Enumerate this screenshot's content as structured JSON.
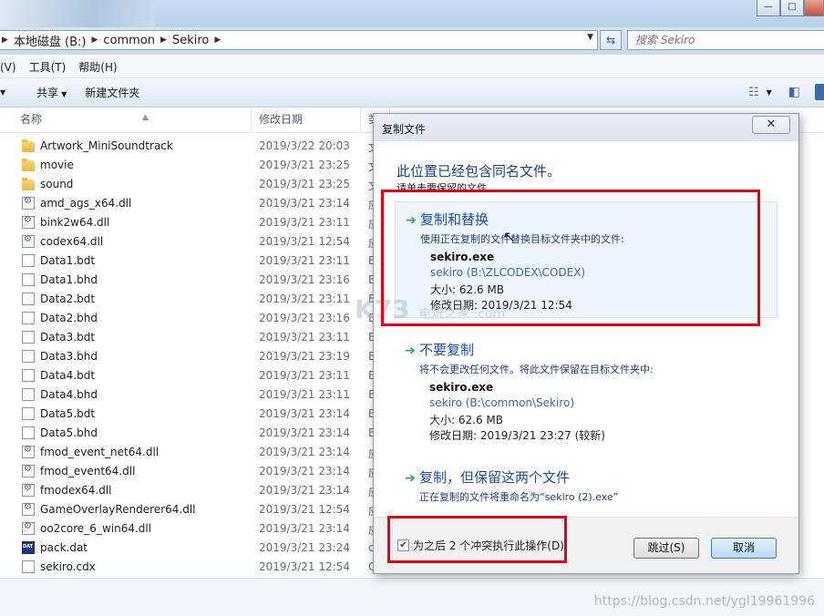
{
  "explorer": {
    "address": {
      "crumbs": [
        "本地磁盘 (B:)",
        "common",
        "Sekiro"
      ]
    },
    "search": {
      "placeholder": "搜索 Sekiro"
    },
    "window_buttons": {
      "minimize": "—",
      "maximize": "□"
    },
    "menu": [
      "(V)",
      "工具(T)",
      "帮助(H)"
    ],
    "toolbar": {
      "share": "共享",
      "new_folder": "新建文件夹"
    },
    "columns": {
      "name": "名称",
      "date": "修改日期",
      "type": "类"
    },
    "files": [
      {
        "name": "Artwork_MiniSoundtrack",
        "date": "2019/3/22 20:03",
        "type": "文",
        "icon": "folder"
      },
      {
        "name": "movie",
        "date": "2019/3/21 23:25",
        "type": "文",
        "icon": "folder"
      },
      {
        "name": "sound",
        "date": "2019/3/21 23:25",
        "type": "文",
        "icon": "folder"
      },
      {
        "name": "amd_ags_x64.dll",
        "date": "2019/3/21 23:14",
        "type": "应",
        "icon": "dll"
      },
      {
        "name": "bink2w64.dll",
        "date": "2019/3/21 23:11",
        "type": "应",
        "icon": "dll"
      },
      {
        "name": "codex64.dll",
        "date": "2019/3/21 12:54",
        "type": "应",
        "icon": "dll"
      },
      {
        "name": "Data1.bdt",
        "date": "2019/3/21 23:11",
        "type": "B",
        "icon": "file"
      },
      {
        "name": "Data1.bhd",
        "date": "2019/3/21 23:16",
        "type": "B",
        "icon": "file"
      },
      {
        "name": "Data2.bdt",
        "date": "2019/3/21 23:11",
        "type": "B",
        "icon": "file"
      },
      {
        "name": "Data2.bhd",
        "date": "2019/3/21 23:16",
        "type": "B",
        "icon": "file"
      },
      {
        "name": "Data3.bdt",
        "date": "2019/3/21 23:11",
        "type": "B",
        "icon": "file"
      },
      {
        "name": "Data3.bhd",
        "date": "2019/3/21 23:19",
        "type": "B",
        "icon": "file"
      },
      {
        "name": "Data4.bdt",
        "date": "2019/3/21 23:11",
        "type": "B",
        "icon": "file"
      },
      {
        "name": "Data4.bhd",
        "date": "2019/3/21 23:11",
        "type": "B",
        "icon": "file"
      },
      {
        "name": "Data5.bdt",
        "date": "2019/3/21 23:14",
        "type": "B",
        "icon": "file"
      },
      {
        "name": "Data5.bhd",
        "date": "2019/3/21 23:14",
        "type": "B",
        "icon": "file"
      },
      {
        "name": "fmod_event_net64.dll",
        "date": "2019/3/21 23:14",
        "type": "应",
        "icon": "dll"
      },
      {
        "name": "fmod_event64.dll",
        "date": "2019/3/21 23:14",
        "type": "应",
        "icon": "dll"
      },
      {
        "name": "fmodex64.dll",
        "date": "2019/3/21 23:14",
        "type": "应",
        "icon": "dll"
      },
      {
        "name": "GameOverlayRenderer64.dll",
        "date": "2019/3/21 12:54",
        "type": "应",
        "icon": "dll"
      },
      {
        "name": "oo2core_6_win64.dll",
        "date": "2019/3/21 23:14",
        "type": "应",
        "icon": "dll"
      },
      {
        "name": "pack.dat",
        "date": "2019/3/21 23:24",
        "type": "d",
        "icon": "dat"
      },
      {
        "name": "sekiro.cdx",
        "date": "2019/3/21 12:54",
        "type": "C",
        "icon": "file"
      }
    ]
  },
  "dialog": {
    "title": "复制文件",
    "close": "✕",
    "heading": "此位置已经包含同名文件。",
    "subheading": "请单击要保留的文件",
    "options": [
      {
        "title": "复制和替换",
        "desc": "使用正在复制的文件替换目标文件夹中的文件:",
        "file": "sekiro.exe",
        "path": "sekiro (B:\\ZLCODEX\\CODEX)",
        "size": "大小: 62.6 MB",
        "modified": "修改日期: 2019/3/21 12:54"
      },
      {
        "title": "不要复制",
        "desc": "将不会更改任何文件。将此文件保留在目标文件夹中:",
        "file": "sekiro.exe",
        "path": "sekiro (B:\\common\\Sekiro)",
        "size": "大小: 62.6 MB",
        "modified": "修改日期: 2019/3/21 23:27 (较新)"
      },
      {
        "title": "复制，但保留这两个文件",
        "desc": "正在复制的文件将重命名为“sekiro (2).exe”"
      }
    ],
    "checkbox_label": "为之后 2 个冲突执行此操作(D)",
    "checkbox_checked": true,
    "skip_button": "跳过(S)",
    "cancel_button": "取消"
  },
  "overlays": {
    "site_watermark": "K73",
    "site_watermark_sub": "电玩之家 .com",
    "blog_watermark": "https://blog.csdn.net/ygl19961996"
  },
  "colors": {
    "highlight": "#e0001a",
    "link_blue": "#1c4fa5",
    "arrow_green": "#2ea84a"
  }
}
